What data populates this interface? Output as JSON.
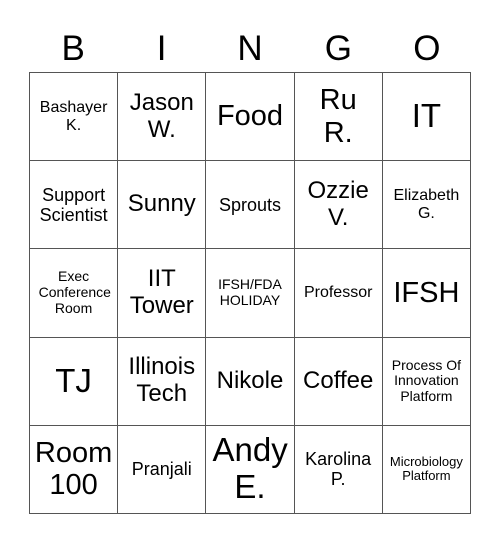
{
  "header": [
    "B",
    "I",
    "N",
    "G",
    "O"
  ],
  "cells": [
    [
      "Bashayer K.",
      "Jason W.",
      "Food",
      "Ru R.",
      "IT"
    ],
    [
      "Support Scientist",
      "Sunny",
      "Sprouts",
      "Ozzie V.",
      "Elizabeth G."
    ],
    [
      "Exec Conference Room",
      "IIT Tower",
      "IFSH/FDA HOLIDAY",
      "Professor",
      "IFSH"
    ],
    [
      "TJ",
      "Illinois Tech",
      "Nikole",
      "Coffee",
      "Process Of Innovation Platform"
    ],
    [
      "Room 100",
      "Pranjali",
      "Andy E.",
      "Karolina P.",
      "Microbiology Platform"
    ]
  ]
}
